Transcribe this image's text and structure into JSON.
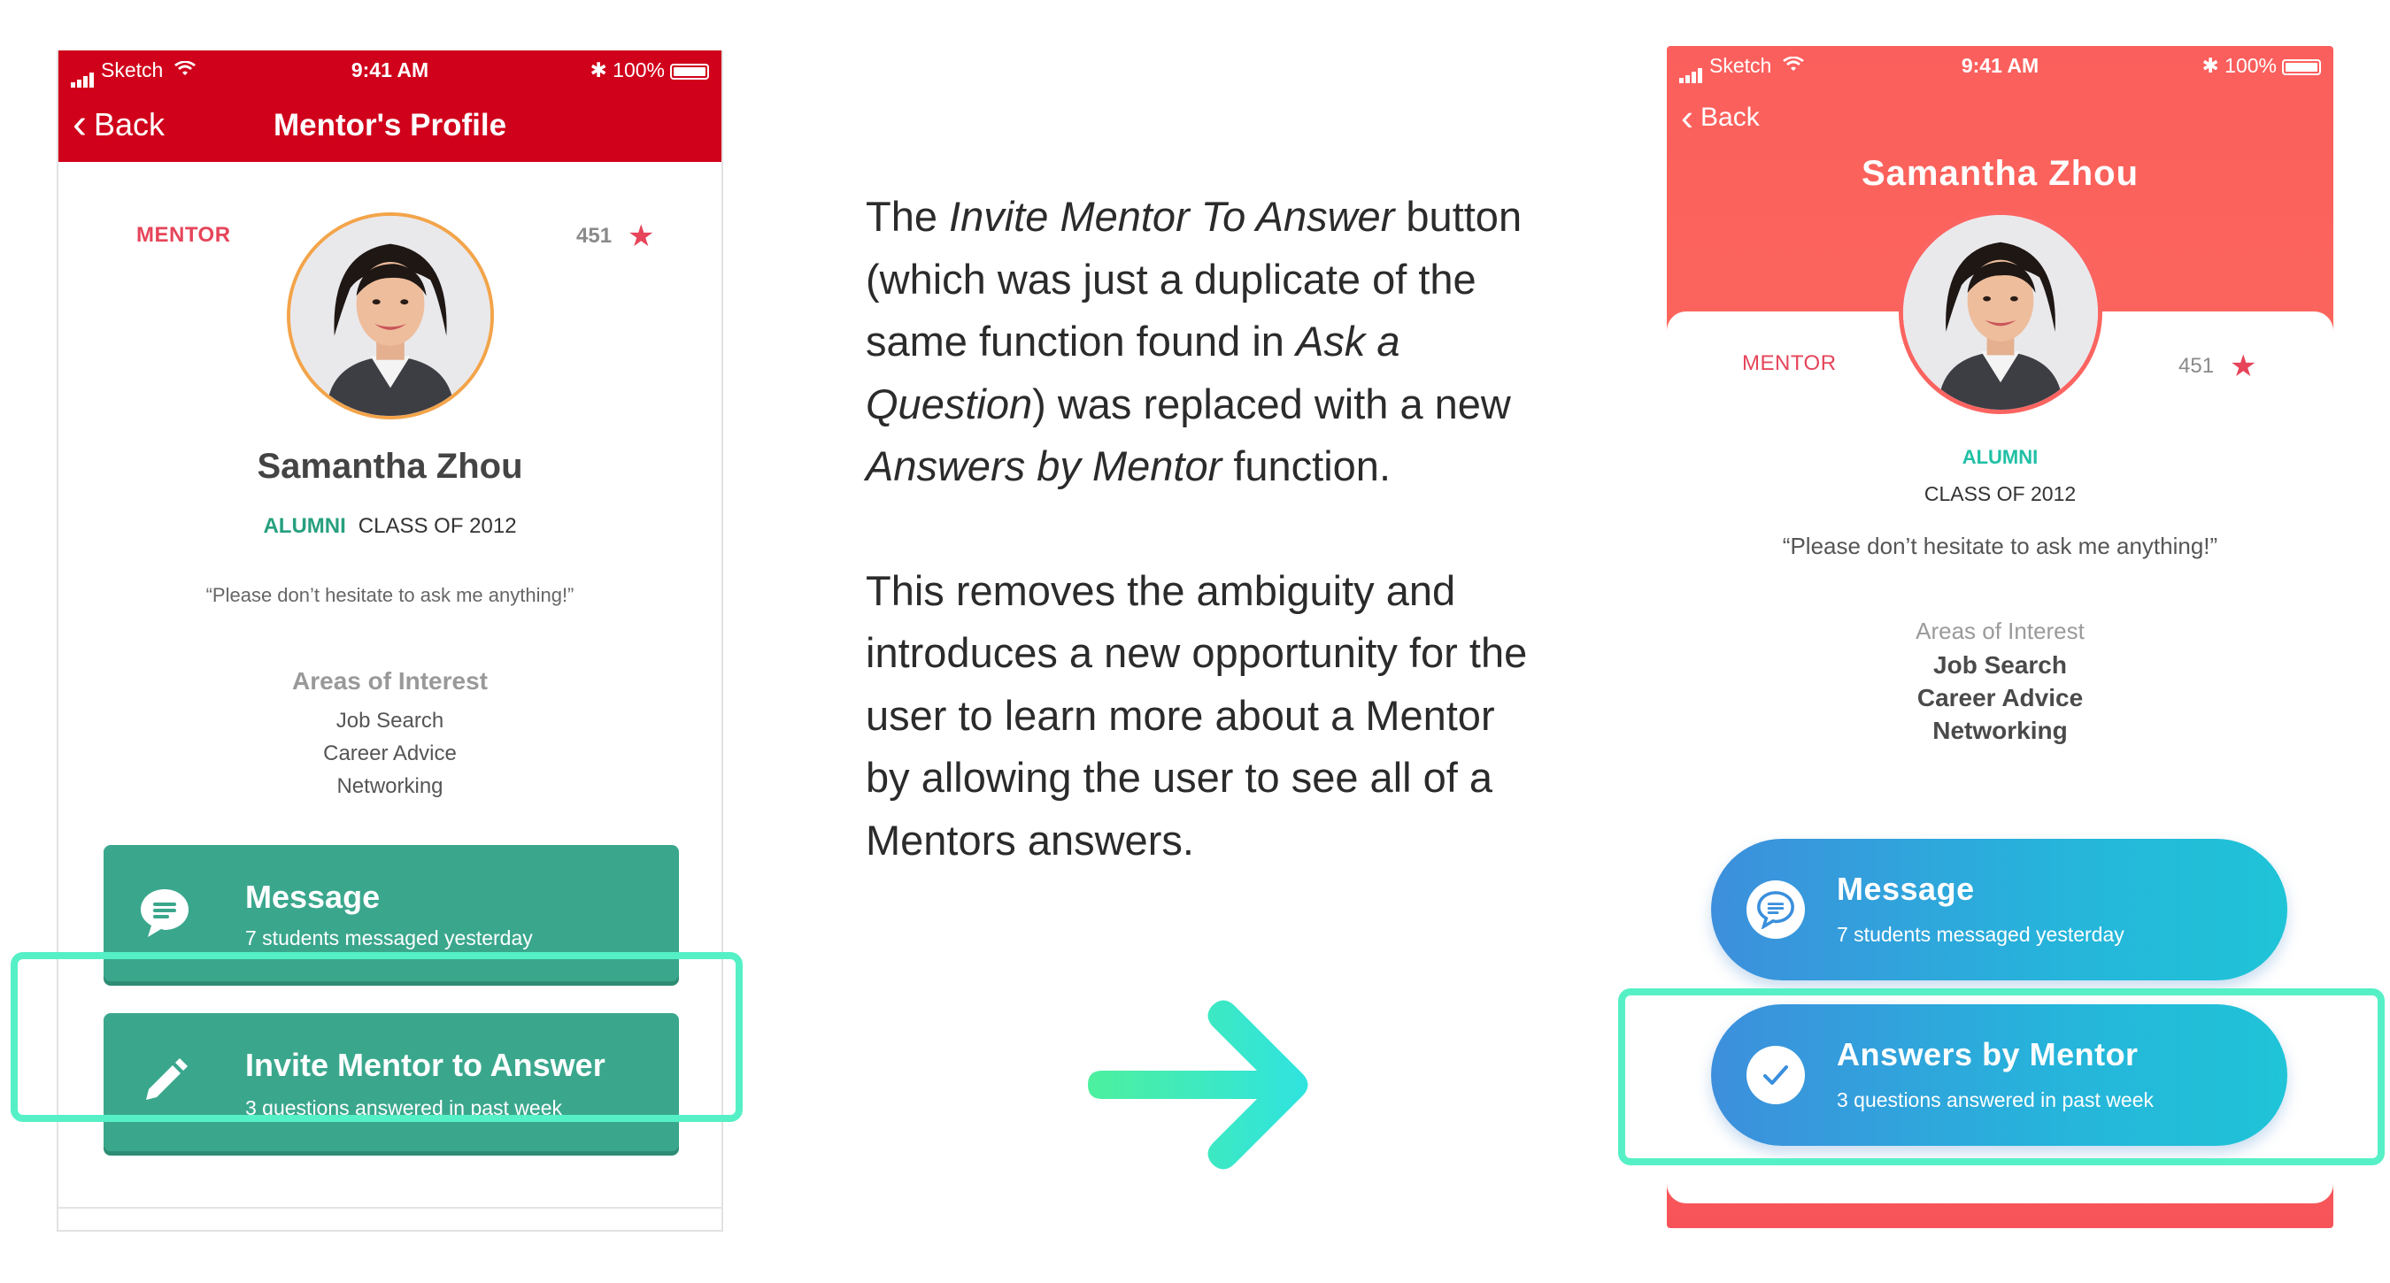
{
  "status_bar": {
    "carrier": "Sketch",
    "time": "9:41 AM",
    "battery": "100%"
  },
  "old_screen": {
    "back_label": "Back",
    "title": "Mentor's Profile",
    "mentor_tag": "MENTOR",
    "rating": "451",
    "name": "Samantha Zhou",
    "alumni_label": "ALUMNI",
    "class_label": "CLASS OF 2012",
    "quote": "“Please don’t hesitate to ask me anything!”",
    "areas_header": "Areas of Interest",
    "areas": [
      "Job Search",
      "Career Advice",
      "Networking"
    ],
    "message_button": {
      "label": "Message",
      "sub": "7 students messaged yesterday",
      "icon": "chat-bubble-icon"
    },
    "invite_button": {
      "label": "Invite Mentor to Answer",
      "sub": "3 questions answered in past week",
      "icon": "pencil-icon"
    },
    "colors": {
      "nav": "#d0021b",
      "button": "#3aa78d",
      "accent": "#e6455a",
      "alumni": "#27a07f"
    }
  },
  "description": {
    "p1_parts": [
      "The ",
      "Invite Mentor To Answer",
      " button (which was just a duplicate of the same function found in ",
      "Ask a Question",
      ") was replaced with a new ",
      "Answers by Mentor",
      " function."
    ],
    "p2": "This removes the ambiguity and introduces a new opportunity for the user to learn more about a Mentor by allowing the user to see all of a Mentors answers."
  },
  "new_screen": {
    "back_label": "Back",
    "name": "Samantha Zhou",
    "mentor_tag": "MENTOR",
    "rating": "451",
    "alumni_label": "ALUMNI",
    "class_label": "CLASS OF 2012",
    "quote": "“Please don’t hesitate to ask me anything!”",
    "areas_header": "Areas of Interest",
    "areas": [
      "Job Search",
      "Career Advice",
      "Networking"
    ],
    "message_button": {
      "label": "Message",
      "sub": "7 students messaged yesterday",
      "icon": "chat-bubble-icon"
    },
    "answers_button": {
      "label": "Answers by Mentor",
      "sub": "3 questions answered in past week",
      "icon": "checkmark-icon"
    },
    "colors": {
      "header_gradient_start": "#fb5f5d",
      "button_gradient_start": "#3d8fdc",
      "button_gradient_end": "#1fc4d7",
      "alumni": "#20c0a5"
    }
  },
  "highlight_color": "#56f0c6",
  "arrow_color": "#3de8b8"
}
